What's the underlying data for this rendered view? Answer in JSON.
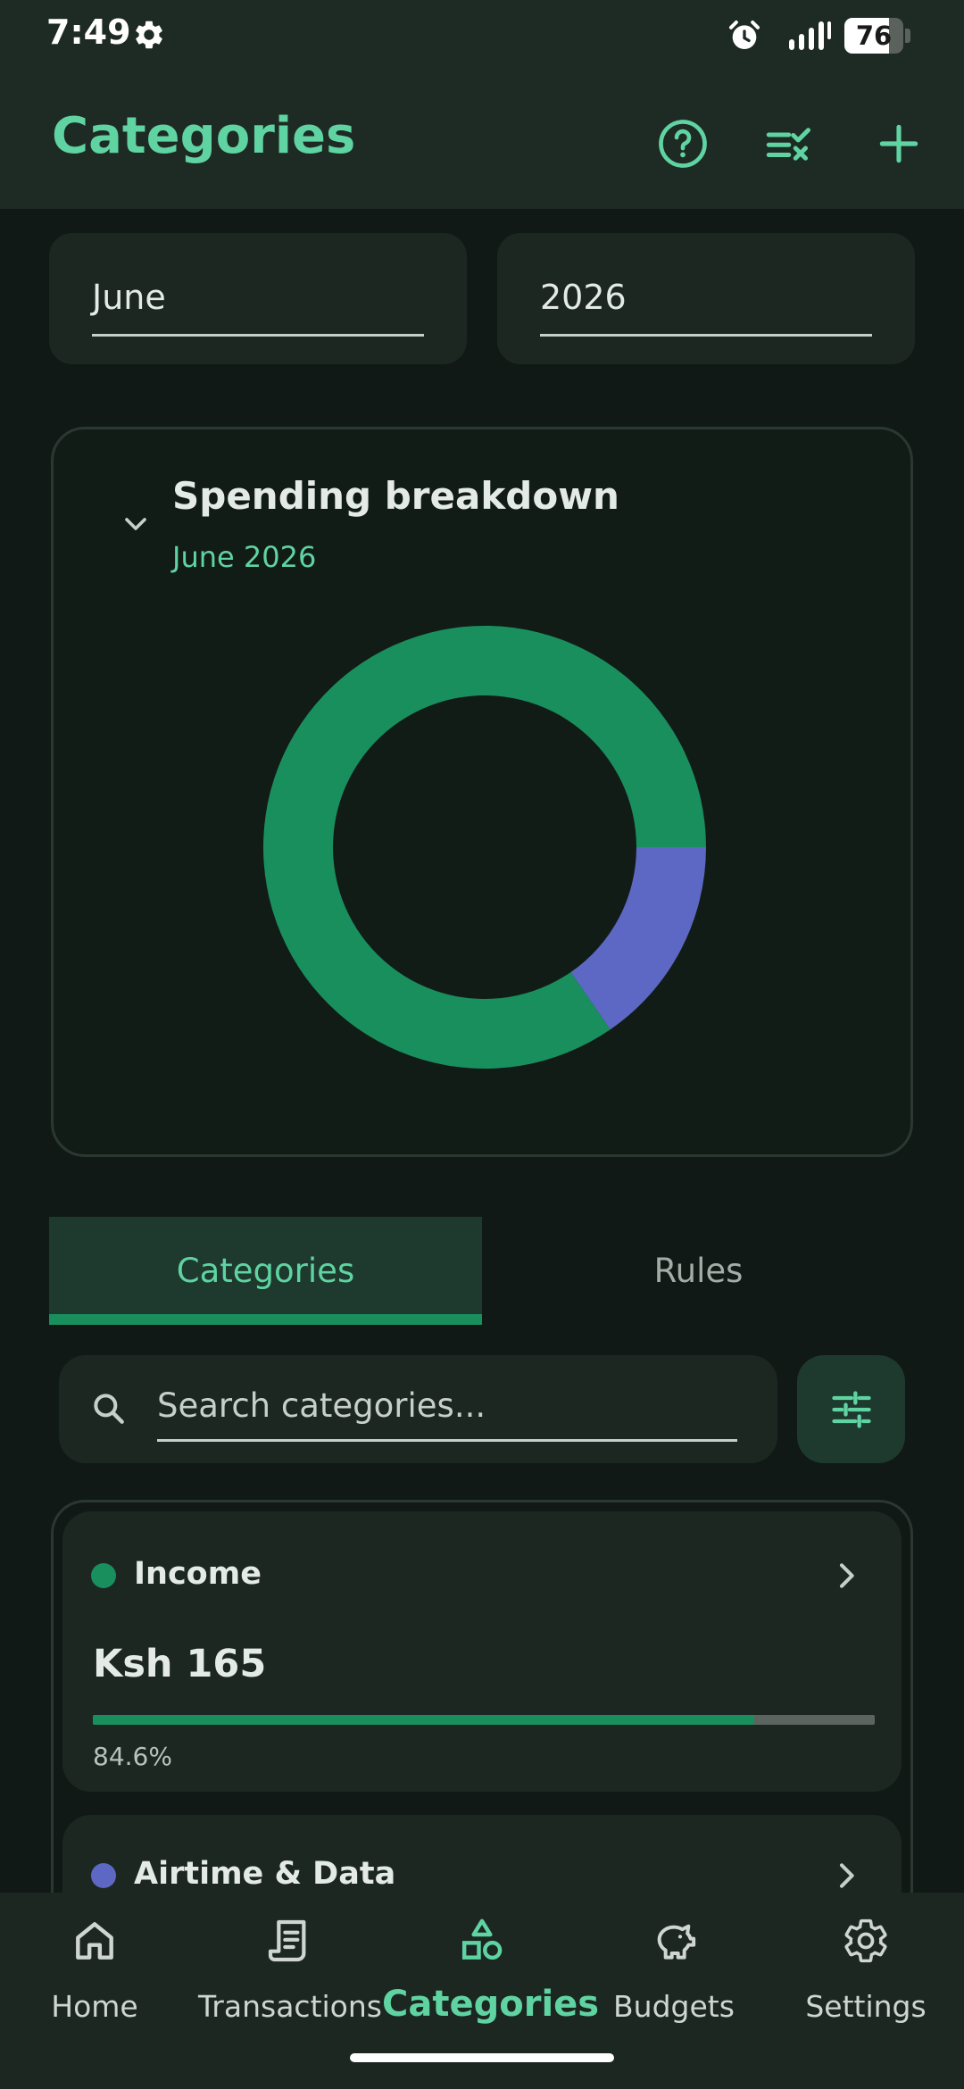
{
  "status_bar": {
    "time": "7:49",
    "battery": "76",
    "battery_level": 0.76,
    "icons": [
      "settings-gear-icon",
      "alarm-clock-icon",
      "signal-bars-icon",
      "battery-icon"
    ]
  },
  "app_bar": {
    "title": "Categories",
    "actions": [
      "help-icon",
      "checklist-icon",
      "add-icon"
    ]
  },
  "filters": {
    "month": "June",
    "year": "2026"
  },
  "spending_breakdown": {
    "title": "Spending breakdown",
    "subtitle": "June 2026",
    "expand_icon": "chevron-down-icon",
    "chart_data": {
      "type": "pie",
      "donut": true,
      "categories": [
        "Income",
        "Airtime & Data"
      ],
      "values": [
        84.6,
        15.4
      ],
      "colors": [
        "#1a8f5e",
        "#5d68c4"
      ]
    }
  },
  "tabs": [
    {
      "label": "Categories",
      "active": true
    },
    {
      "label": "Rules",
      "active": false
    }
  ],
  "search": {
    "placeholder": "Search categories...",
    "value": "",
    "icon": "search-icon",
    "filter_icon": "tune-sliders-icon"
  },
  "categories": [
    {
      "name": "Income",
      "amount": "Ksh 165",
      "percent": "84.6%",
      "fraction": 0.846,
      "color": "#1a8f5e"
    },
    {
      "name": "Airtime & Data",
      "color": "#5d68c4"
    }
  ],
  "bottom_nav": [
    {
      "label": "Home",
      "icon": "home-icon",
      "active": false
    },
    {
      "label": "Transactions",
      "icon": "receipt-icon",
      "active": false
    },
    {
      "label": "Categories",
      "icon": "shapes-icon",
      "active": true
    },
    {
      "label": "Budgets",
      "icon": "piggy-bank-icon",
      "active": false
    },
    {
      "label": "Settings",
      "icon": "gear-icon",
      "active": false
    }
  ],
  "colors": {
    "accent": "#5fd3a1",
    "primary_green": "#1a8f5e",
    "secondary_blue": "#5d68c4",
    "background": "#101915",
    "surface": "#1c2722"
  }
}
